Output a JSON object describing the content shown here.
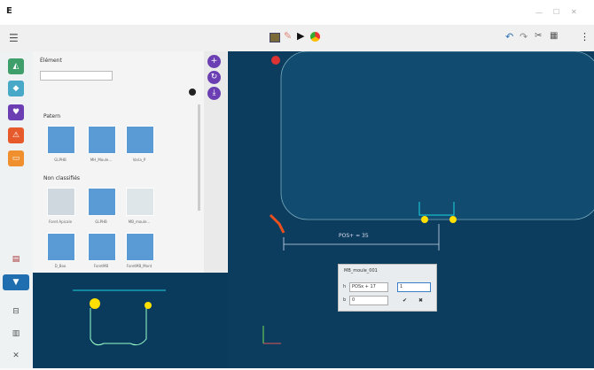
{
  "app": {
    "logo_letter": "E"
  },
  "panel": {
    "section_element": "Élément",
    "search_value": "",
    "section_patterns": "Patern",
    "patterns": [
      "GLPHB",
      "MH_Moule...",
      "Varia_P"
    ],
    "section_non_classified": "Non classifiés",
    "non_classified": [
      "Foret Apicale",
      "GLPHB",
      "MB_moule...",
      "D_Boo",
      "ForetMB",
      "ForetMB_Mont"
    ]
  },
  "canvas": {
    "dimension_label": "POS+  =  35"
  },
  "dialog": {
    "title": "MB_moule_001",
    "field1_label": "h",
    "field1_value": "POSx + 17",
    "field1_extra": "1",
    "field2_label": "b",
    "field2_value": "0",
    "ok_label": "✔",
    "cancel_label": "✖"
  },
  "colors": {
    "canvas_bg": "#0d3d5e",
    "accent_purple": "#6b3fb3",
    "accent_cyan": "#19d3e0",
    "marker_yellow": "#ffe000",
    "marker_orange": "#e8501f"
  }
}
